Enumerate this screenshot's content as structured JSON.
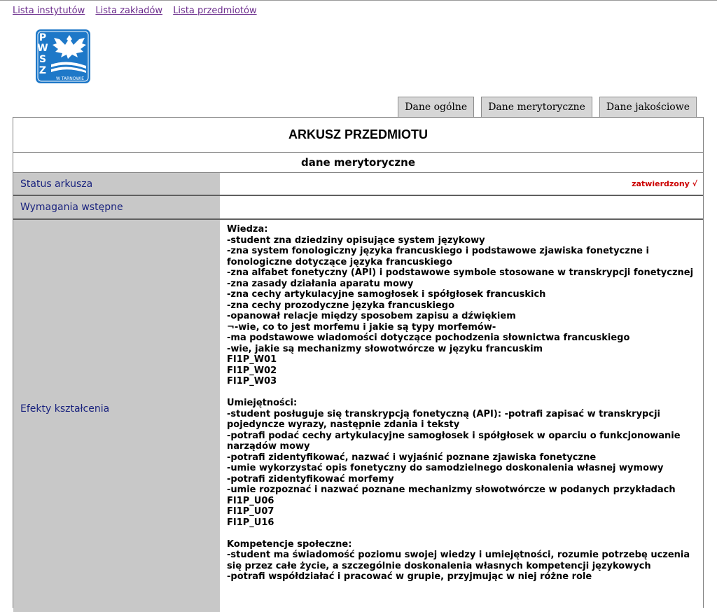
{
  "nav": {
    "links": [
      "Lista instytutów",
      "Lista zakładów",
      "Lista przedmiotów"
    ]
  },
  "logo": {
    "letters": [
      "P",
      "W",
      "S",
      "Z"
    ],
    "caption": "W TARNOWIE",
    "color": "#1e78c8"
  },
  "tabs": [
    "Dane ogólne",
    "Dane merytoryczne",
    "Dane jakościowe"
  ],
  "sheet": {
    "title": "ARKUSZ PRZEDMIOTU",
    "subtitle": "dane merytoryczne",
    "rows": {
      "status": {
        "label": "Status arkusza",
        "value": "zatwierdzony √"
      },
      "wymagania": {
        "label": "Wymagania wstępne",
        "value": ""
      },
      "efekty": {
        "label": "Efekty kształcenia",
        "lines": [
          "Wiedza:",
          "-student zna dziedziny opisujące system językowy",
          "-zna system fonologiczny języka francuskiego i podstawowe zjawiska fonetyczne i",
          "fonologiczne dotyczące języka francuskiego",
          "-zna alfabet fonetyczny (API) i podstawowe symbole stosowane w transkrypcji fonetycznej",
          "-zna zasady działania aparatu mowy",
          "-zna cechy artykulacyjne samogłosek i spółgłosek francuskich",
          "-zna cechy prozodyczne języka francuskiego",
          "-opanował relacje między sposobem zapisu a dźwiękiem",
          "¬-wie, co to jest morfemu i jakie są typy morfemów-",
          "-ma podstawowe wiadomości dotyczące pochodzenia słownictwa francuskiego",
          "-wie, jakie są mechanizmy słowotwórcze w języku francuskim",
          "FI1P_W01",
          "FI1P_W02",
          "FI1P_W03",
          "",
          "Umiejętności:",
          "-student posługuje się transkrypcją fonetyczną (API): -potrafi zapisać w transkrypcji",
          "pojedyncze wyrazy, następnie zdania i teksty",
          "-potrafi podać cechy artykulacyjne samogłosek i spółgłosek w oparciu o funkcjonowanie",
          "narządów mowy",
          "-potrafi zidentyfikować, nazwać i wyjaśnić poznane zjawiska fonetyczne",
          "-umie wykorzystać opis fonetyczny do samodzielnego doskonalenia własnej wymowy",
          "-potrafi zidentyfikować morfemy",
          "-umie rozpoznać i nazwać poznane mechanizmy słowotwórcze w podanych przykładach",
          "FI1P_U06",
          "FI1P_U07",
          "FI1P_U16",
          "",
          "Kompetencje społeczne:",
          "-student ma świadomość poziomu swojej wiedzy i umiejętności, rozumie potrzebę uczenia",
          "się przez całe życie, a szczególnie doskonalenia własnych kompetencji językowych",
          "-potrafi współdziałać i pracować w grupie, przyjmując w niej różne role"
        ]
      }
    }
  }
}
